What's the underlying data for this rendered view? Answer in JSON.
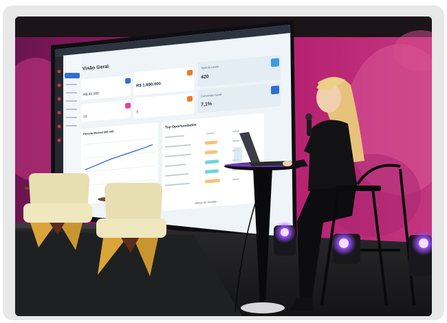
{
  "dashboard": {
    "title": "Visão Geral",
    "metric_1_value": "R$ 40.000",
    "metric_2_value": "R$ 1.890.000",
    "metric_3_label": "Total de Leads",
    "metric_3_value": "420",
    "metric_4_value": "10",
    "metric_5_value": "3",
    "metric_6_label": "Conversão Geral",
    "metric_6_value": "7,1%",
    "chart_title": "Receita Mensal (R$ mil)",
    "table_title": "Top Oportunidades",
    "footer_label": "Metas de Vendas"
  },
  "colors": {
    "backdrop": "#c2185b",
    "screen_bg": "#eef4f7",
    "accent_blue": "#2f6fd6",
    "stage_light": "#8b3cff"
  }
}
